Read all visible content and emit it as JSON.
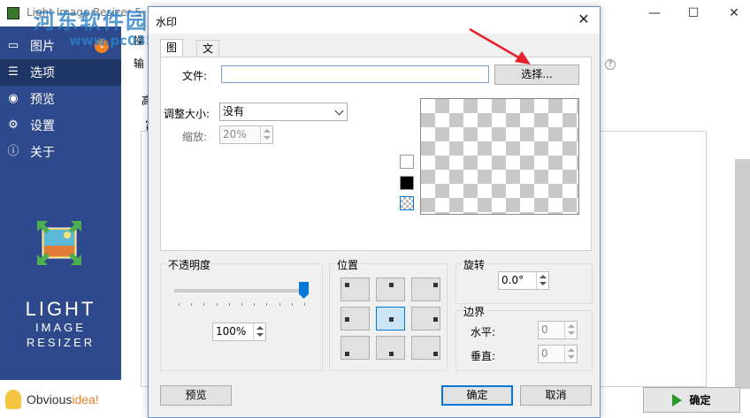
{
  "app": {
    "title": "Light Image Resizer 5",
    "sidebar": {
      "items": [
        {
          "label": "图片",
          "icon": "images-icon"
        },
        {
          "label": "选项",
          "icon": "sliders-icon"
        },
        {
          "label": "预览",
          "icon": "eye-icon"
        },
        {
          "label": "设置",
          "icon": "gear-icon"
        },
        {
          "label": "关于",
          "icon": "info-icon"
        }
      ],
      "badge": "1",
      "brand": {
        "line1": "LIGHT",
        "line2": "IMAGE",
        "line3": "RESIZER"
      },
      "vendor": {
        "prefix": "Obvious",
        "suffix": "idea!"
      }
    },
    "main": {
      "fragments": [
        "操",
        "输",
        "高",
        "富"
      ],
      "ok_label": "确定"
    },
    "watermark": {
      "cn": "河东软件园",
      "url": "www.pc0359.cn"
    }
  },
  "dialog": {
    "title": "水印",
    "tabs": [
      "图片",
      "文字"
    ],
    "file": {
      "label": "文件:",
      "value": "",
      "browse_label": "选择..."
    },
    "resize": {
      "label": "调整大小:",
      "selected": "没有"
    },
    "scale": {
      "label": "缩放:",
      "value": "20%"
    },
    "background_swatches": [
      "#ffffff",
      "#000000",
      "transparent"
    ],
    "opacity": {
      "title": "不透明度",
      "value": "100%",
      "level_percent": 100
    },
    "position": {
      "title": "位置",
      "selected_index": 4
    },
    "rotation": {
      "title": "旋转",
      "value": "0.0°"
    },
    "margin": {
      "title": "边界",
      "horizontal_label": "水平:",
      "horizontal_value": "0",
      "vertical_label": "垂直:",
      "vertical_value": "0"
    },
    "buttons": {
      "preview": "预览",
      "ok": "确定",
      "cancel": "取消"
    }
  },
  "colors": {
    "sidebar": "#2f4a8c",
    "accent": "#0078d7",
    "annotation": "#e8202a"
  }
}
